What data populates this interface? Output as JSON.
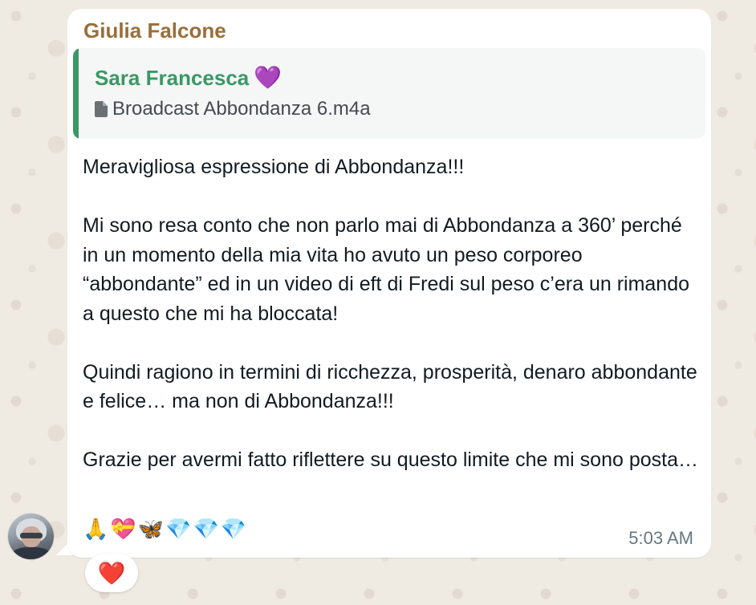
{
  "message": {
    "sender": "Giulia Falcone",
    "quoted": {
      "author": "Sara  Francesca",
      "author_emoji": "💜",
      "file_icon": "document-icon",
      "file_name": "Broadcast Abbondanza 6.m4a"
    },
    "paragraphs": [
      "Meravigliosa espressione di Abbondanza!!!",
      "Mi sono resa conto che non parlo mai di Abbondanza a 360’ perché in un momento della mia vita ho avuto un peso corporeo “abbondante” ed in un video di eft di Fredi sul peso c’era un rimando a questo che mi ha bloccata!",
      "Quindi ragiono in termini di ricchezza, prosperità, denaro abbondante e felice… ma non di Abbondanza!!!",
      "Grazie per avermi fatto riflettere su questo limite che mi sono posta…"
    ],
    "emoji_line": "🙏💝🦋💎💎💎",
    "time": "5:03 AM",
    "reaction": "❤️"
  },
  "colors": {
    "sender_name": "#9a6e3a",
    "quote_accent": "#3a9865",
    "background": "#efeae2"
  }
}
